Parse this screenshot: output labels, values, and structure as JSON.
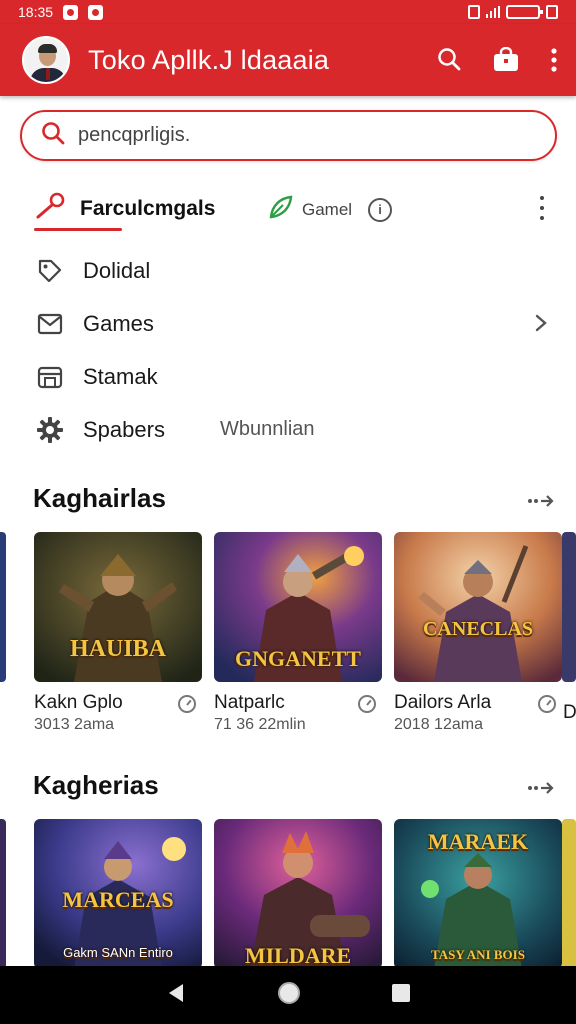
{
  "status_bar": {
    "time": "18:35"
  },
  "app_bar": {
    "title": "Toko Apllk.J ldaaaia"
  },
  "search": {
    "placeholder": "pencqprligis."
  },
  "tabs": {
    "active_label": "Farculcmgals",
    "second_label": "Gamel",
    "info_glyph": "i"
  },
  "menu": {
    "items": [
      {
        "label": "Dolidal",
        "icon": "tag-icon"
      },
      {
        "label": "Games",
        "icon": "envelope-icon"
      },
      {
        "label": "Stamak",
        "icon": "store-icon"
      },
      {
        "label": "Spabers",
        "icon": "gear-icon",
        "sub": "Wbunnlian"
      }
    ]
  },
  "sections": [
    {
      "title": "Kaghairlas",
      "cards": [
        {
          "title": "Kakn Gplo",
          "meta": "3013 2ama",
          "art_text": "HAUIBA"
        },
        {
          "title": "Natparlc",
          "meta": "71 36 22mlin",
          "art_text": "GNGANETT"
        },
        {
          "title": "Dailors Arla",
          "meta": "2018 12ama",
          "art_text": "CANECLAS"
        }
      ],
      "partial_title": "D"
    },
    {
      "title": "Kagherias",
      "cards": [
        {
          "art_text": "MARCEAS",
          "art_caption": "Gakm SANn Entiro"
        },
        {
          "art_text": "MILDARE"
        },
        {
          "art_text": "MARAEK",
          "art_caption": "TASY ANI BOIS"
        }
      ]
    }
  ],
  "colors": {
    "accent": "#d8282c",
    "background": "#ffffff"
  }
}
